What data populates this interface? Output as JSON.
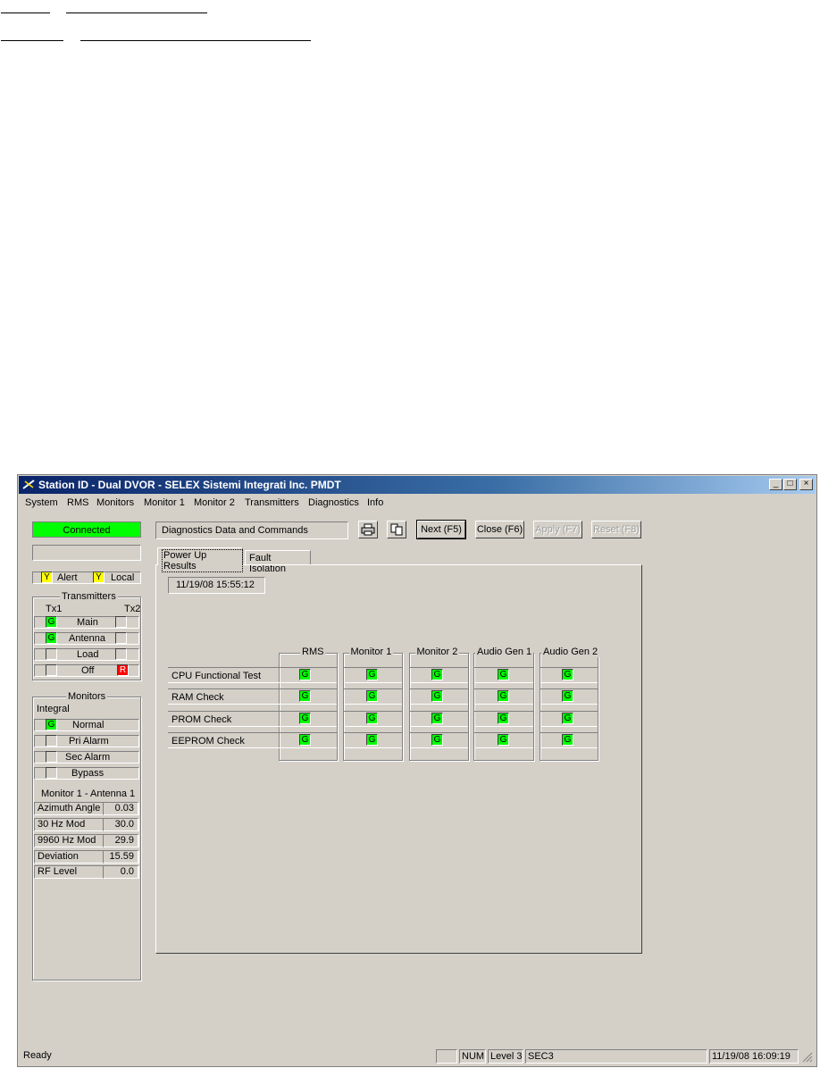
{
  "window": {
    "title": "Station ID - Dual DVOR - SELEX Sistemi Integrati Inc. PMDT",
    "controls": {
      "minimize": "_",
      "maximize": "□",
      "close": "×"
    }
  },
  "menu": [
    "System",
    "RMS",
    "Monitors",
    "Monitor 1",
    "Monitor 2",
    "Transmitters",
    "Diagnostics",
    "Info"
  ],
  "left": {
    "connection": "Connected",
    "alert_label": "Alert",
    "alert_led": "Y",
    "local_label": "Local",
    "local_led": "Y",
    "transmitters": {
      "title": "Transmitters",
      "tx1": "Tx1",
      "tx2": "Tx2",
      "rows": [
        {
          "label": "Main",
          "left": "G",
          "right": ""
        },
        {
          "label": "Antenna",
          "left": "G",
          "right": ""
        },
        {
          "label": "Load",
          "left": "",
          "right": ""
        },
        {
          "label": "Off",
          "left": "",
          "right": "R"
        }
      ]
    },
    "monitors": {
      "title": "Monitors",
      "integral": "Integral",
      "rows": [
        {
          "label": "Normal",
          "led": "G"
        },
        {
          "label": "Pri Alarm",
          "led": ""
        },
        {
          "label": "Sec Alarm",
          "led": ""
        },
        {
          "label": "Bypass",
          "led": ""
        }
      ],
      "section": "Monitor 1 - Antenna 1",
      "params": [
        {
          "label": "Azimuth Angle",
          "value": "0.03"
        },
        {
          "label": "30 Hz Mod",
          "value": "30.0"
        },
        {
          "label": "9960 Hz Mod",
          "value": "29.9"
        },
        {
          "label": "Deviation",
          "value": "15.59"
        },
        {
          "label": "RF Level",
          "value": "0.0"
        }
      ]
    }
  },
  "toolbar": {
    "panel_title": "Diagnostics Data and Commands",
    "print_icon": "printer-icon",
    "copy_icon": "copy-icon",
    "next": "Next (F5)",
    "close": "Close (F6)",
    "apply": "Apply (F7)",
    "reset": "Reset (F8)"
  },
  "tabs": [
    "Power Up Results",
    "Fault Isolation"
  ],
  "results": {
    "timestamp": "11/19/08 15:55:12",
    "columns": [
      "RMS",
      "Monitor 1",
      "Monitor 2",
      "Audio Gen 1",
      "Audio Gen 2"
    ],
    "rows": [
      {
        "label": "CPU Functional Test",
        "values": [
          "G",
          "G",
          "G",
          "G",
          "G"
        ]
      },
      {
        "label": "RAM Check",
        "values": [
          "G",
          "G",
          "G",
          "G",
          "G"
        ]
      },
      {
        "label": "PROM Check",
        "values": [
          "G",
          "G",
          "G",
          "G",
          "G"
        ]
      },
      {
        "label": "EEPROM Check",
        "values": [
          "G",
          "G",
          "G",
          "G",
          "G"
        ]
      }
    ]
  },
  "statusbar": {
    "ready": "Ready",
    "num": "NUM",
    "level": "Level 3",
    "sec": "SEC3",
    "datetime": "11/19/08 16:09:19"
  },
  "colors": {
    "green": "#00ff00",
    "yellow": "#ffff00",
    "red": "#ff0000",
    "titlebar": "#0a246a",
    "face": "#d4d0c8"
  }
}
